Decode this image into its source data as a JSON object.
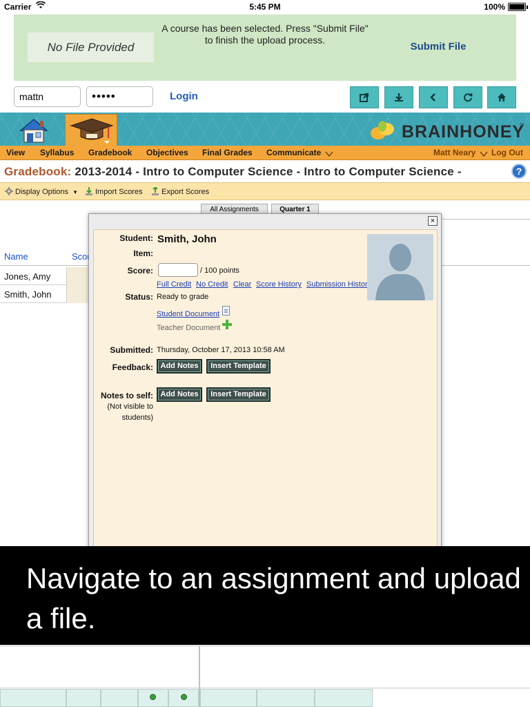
{
  "status_bar": {
    "carrier": "Carrier",
    "time": "5:45 PM",
    "battery": "100%"
  },
  "upload": {
    "file_label": "No File Provided",
    "message": "A course has been selected. Press \"Submit File\" to finish the upload process.",
    "submit_label": "Submit File"
  },
  "login": {
    "username": "mattn",
    "password": "•••••",
    "login_label": "Login"
  },
  "toolbar_buttons": [
    "share-icon",
    "download-icon",
    "back-icon",
    "refresh-icon",
    "home-icon"
  ],
  "brand": {
    "name": "BRAINHONEY",
    "tm": "™"
  },
  "menu": {
    "items": [
      "View",
      "Syllabus",
      "Gradebook",
      "Objectives",
      "Final Grades",
      "Communicate"
    ],
    "user_name": "Matt Neary",
    "logout": "Log Out"
  },
  "gradebook": {
    "label": "Gradebook:",
    "title": "2013-2014 - Intro to Computer Science - Intro to Computer Science -",
    "help": "?"
  },
  "toolbar2": {
    "display_options": "Display Options",
    "import_scores": "Import Scores",
    "export_scores": "Export Scores"
  },
  "grid": {
    "tabs": [
      "All Assignments",
      "Quarter 1"
    ],
    "col_name": "Name",
    "col_score": "Scor",
    "students": [
      "Jones, Amy",
      "Smith, John"
    ]
  },
  "modal": {
    "close": "×",
    "student_label": "Student:",
    "student_name": "Smith, John",
    "item_label": "Item:",
    "score_label": "Score:",
    "score_value": "",
    "score_suffix": "/ 100 points",
    "score_links": [
      "Full Credit",
      "No Credit",
      "Clear",
      "Score History",
      "Submission Histor"
    ],
    "status_label": "Status:",
    "status_value": "Ready to grade",
    "student_document": "Student Document",
    "teacher_document": "Teacher Document",
    "submitted_label": "Submitted:",
    "submitted_value": "Thursday, October 17, 2013 10:58 AM",
    "feedback_label": "Feedback:",
    "notes_self_label": "Notes to self:",
    "notes_self_note_1": "(Not visible to",
    "notes_self_note_2": "students)",
    "add_notes": "Add Notes",
    "insert_template": "Insert Template"
  },
  "caption": "Navigate to an assignment and upload a file.",
  "colors": {
    "banner": "#cfe7c5",
    "teal_button": "#4dbcbd",
    "header_teal": "#3fa6b6",
    "menu_orange": "#f4a63b",
    "link_blue": "#1a3db8",
    "modal_bg": "#fcf1dc"
  }
}
